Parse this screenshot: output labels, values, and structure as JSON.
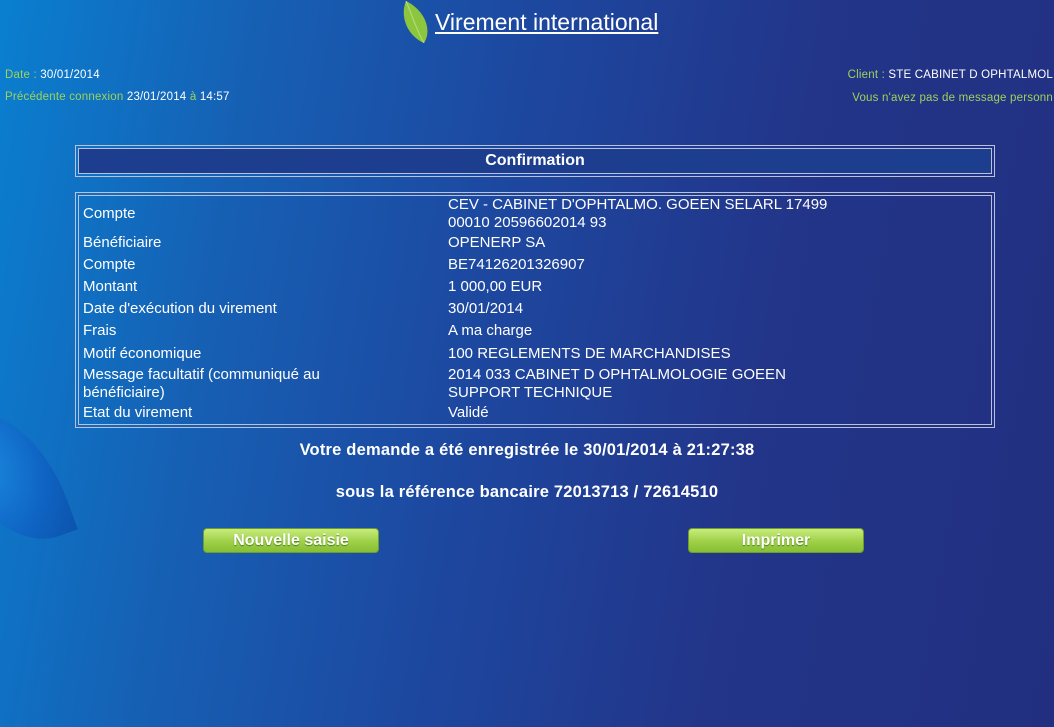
{
  "header": {
    "title": "Virement international"
  },
  "meta": {
    "date_label": "Date : ",
    "date_value": "30/01/2014",
    "prev_label": "Précédente connexion ",
    "prev_date": "23/01/2014",
    "prev_at": "à",
    "prev_time": "14:57",
    "client_label": "Client : ",
    "client_value": "STE CABINET D OPHTALMOL",
    "message": "Vous n'avez pas de message personn"
  },
  "confirmation": {
    "heading": "Confirmation",
    "rows": [
      {
        "label": "Compte",
        "value": "CEV - CABINET D'OPHTALMO. GOEEN SELARL 17499 00010 20596602014 93"
      },
      {
        "label": "Bénéficiaire",
        "value": "OPENERP SA"
      },
      {
        "label": "Compte",
        "value": "BE74126201326907"
      },
      {
        "label": "Montant",
        "value": "1 000,00 EUR"
      },
      {
        "label": "Date d'exécution du virement",
        "value": "30/01/2014"
      },
      {
        "label": "Frais",
        "value": "A ma charge"
      },
      {
        "label": "Motif économique",
        "value": "100 REGLEMENTS DE MARCHANDISES"
      },
      {
        "label": "Message facultatif (communiqué au bénéficiaire)",
        "value": "2014 033 CABINET D OPHTALMOLOGIE GOEEN SUPPORT TECHNIQUE"
      },
      {
        "label": "Etat du virement",
        "value": "Validé"
      }
    ]
  },
  "notice": {
    "line1_prefix": "Votre demande a été enregistrée le ",
    "line1_date": "30/01/2014",
    "line1_at": " à ",
    "line1_time": "21:27:38",
    "line2_prefix": "sous la référence bancaire ",
    "line2_ref": "72013713 / 72614510"
  },
  "buttons": {
    "new_entry": "Nouvelle saisie",
    "print": "Imprimer"
  },
  "colors": {
    "accent_green": "#9dd35a",
    "background_blue": "#1d48a0"
  }
}
